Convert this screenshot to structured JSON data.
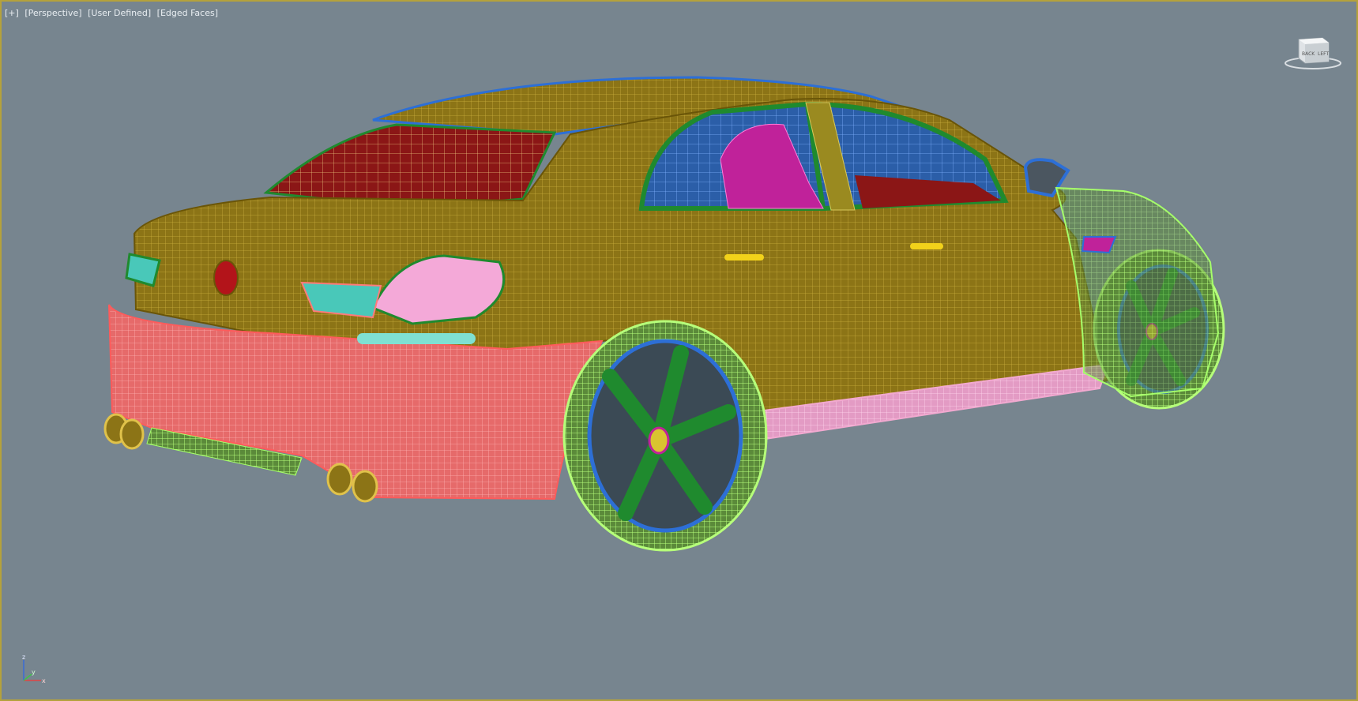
{
  "viewport": {
    "labels": [
      "[+]",
      "[Perspective]",
      "[User Defined]",
      "[Edged Faces]"
    ]
  },
  "viewcube": {
    "face_label": "BACK",
    "side_label": "LEFT"
  },
  "axis_triad": {
    "z": "z",
    "x": "x",
    "y": "y"
  },
  "colors": {
    "background": "#77858f",
    "border": "#b5a23c",
    "body": "#9a7d12",
    "bumper": "#ef6a6a",
    "wheel_wire": "#9af05f",
    "rim": "#1f8a2e",
    "skirt": "#f2a9d0"
  }
}
